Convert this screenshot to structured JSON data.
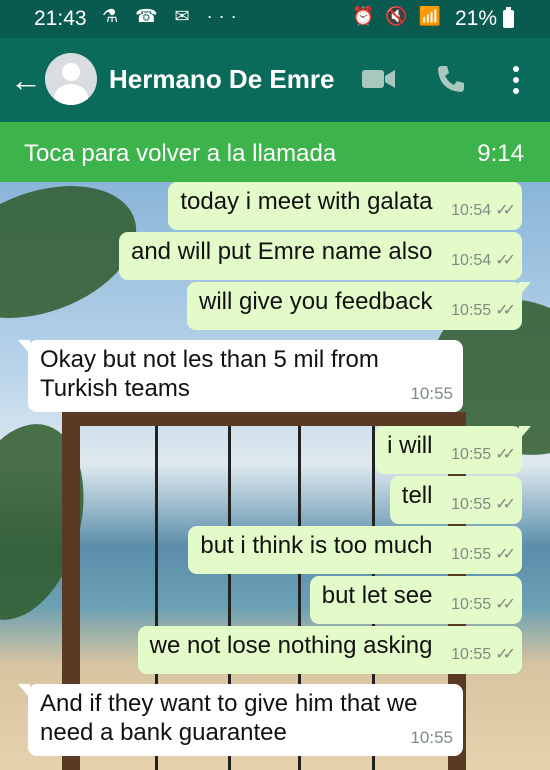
{
  "statusbar": {
    "time": "21:43",
    "left_icons": "⚗ ☎ ✉ ···",
    "right_icons": "⏰ 🔇 📶",
    "battery": "21%"
  },
  "header": {
    "back_icon": "←",
    "contact_name": "Hermano De Emre"
  },
  "call_banner": {
    "label": "Toca para volver a la llamada",
    "duration": "9:14"
  },
  "messages": [
    {
      "dir": "out",
      "text": "today i meet with galata",
      "time": "10:54"
    },
    {
      "dir": "out",
      "text": "and will put Emre name also",
      "time": "10:54"
    },
    {
      "dir": "out",
      "text": "will give you feedback",
      "time": "10:55"
    },
    {
      "dir": "in",
      "text_line1": "Okay but not les than 5 mil from",
      "text_line2": "Turkish teams",
      "time": "10:55"
    },
    {
      "dir": "out",
      "text": "i will",
      "time": "10:55"
    },
    {
      "dir": "out",
      "text": "tell",
      "time": "10:55"
    },
    {
      "dir": "out",
      "text": "but i think is too much",
      "time": "10:55"
    },
    {
      "dir": "out",
      "text": "but let see",
      "time": "10:55"
    },
    {
      "dir": "out",
      "text": "we not lose nothing asking",
      "time": "10:55"
    },
    {
      "dir": "in",
      "text_line1": "And if they want to give him that we",
      "text_line2": "need a bank guarantee",
      "time": "10:55"
    }
  ],
  "checkmark": "✓✓",
  "colors": {
    "header": "#0b6b5a",
    "call_banner": "#3db34c",
    "outgoing_bubble": "#e2fbc8",
    "incoming_bubble": "#ffffff"
  }
}
